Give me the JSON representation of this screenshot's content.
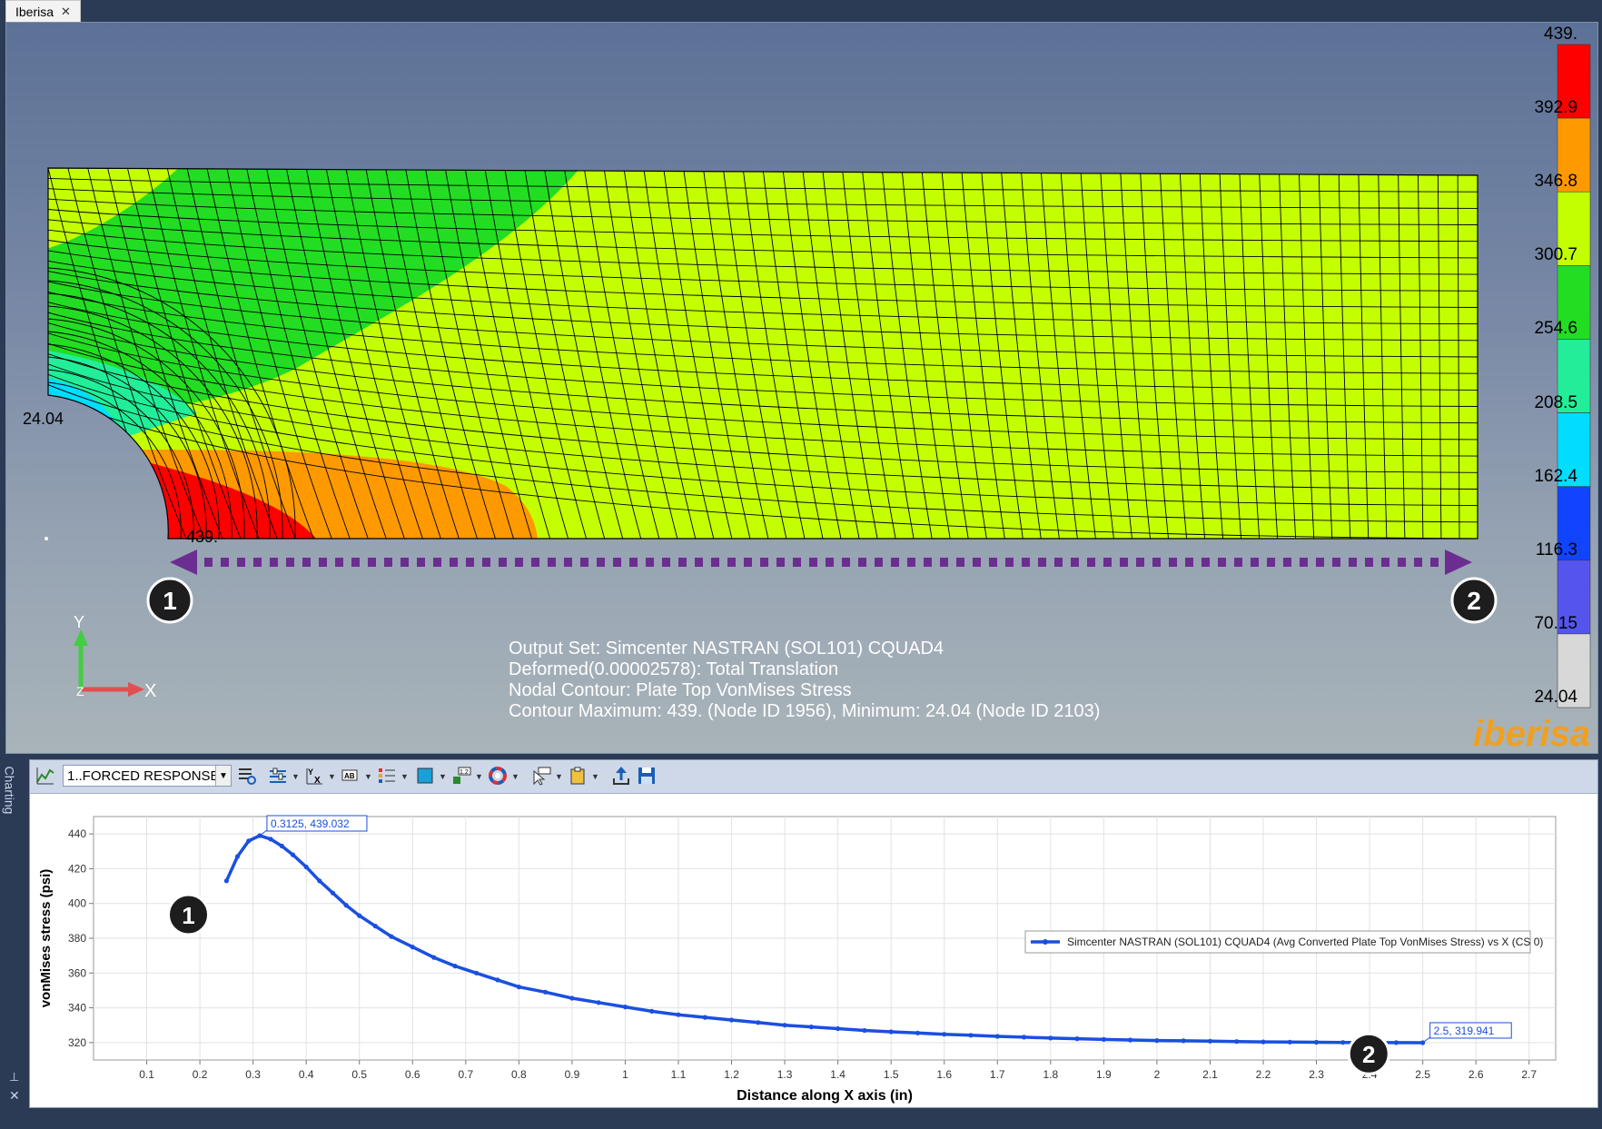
{
  "window": {
    "tab_label": "Iberisa",
    "tab_close": "✕"
  },
  "viewport": {
    "legend": [
      "439.",
      "392.9",
      "346.8",
      "300.7",
      "254.6",
      "208.5",
      "162.4",
      "116.3",
      "70.15",
      "24.04"
    ],
    "legend_colors": [
      "#ff0000",
      "#ff9900",
      "#c4ff00",
      "#22dd22",
      "#22ee99",
      "#00ddff",
      "#1144ff",
      "#5555ee",
      "#d8d8d8"
    ],
    "contour_min_label": "24.04",
    "contour_max_label": "439.",
    "markers": {
      "start": "1",
      "end": "2"
    },
    "axes": {
      "y": "Y",
      "x": "X",
      "z": "Z"
    },
    "info_lines": [
      "Output Set: Simcenter NASTRAN (SOL101) CQUAD4",
      "Deformed(0.00002578): Total Translation",
      "Nodal Contour: Plate Top VonMises Stress",
      "Contour Maximum: 439. (Node ID 1956), Minimum: 24.04 (Node ID 2103)"
    ],
    "logo": "iberisa"
  },
  "side_panel": {
    "label": "Charting",
    "pin": "⊥",
    "close": "✕"
  },
  "toolbar": {
    "chart_select": "1..FORCED RESPONSE"
  },
  "chart_data": {
    "type": "line",
    "xlabel": "Distance along X axis (in)",
    "ylabel": "vonMises stress (psi)",
    "xlim": [
      0.0,
      2.75
    ],
    "ylim": [
      310,
      450
    ],
    "xticks": [
      "0.1",
      "0.2",
      "0.3",
      "0.4",
      "0.5",
      "0.6",
      "0.7",
      "0.8",
      "0.9",
      "1",
      "1.1",
      "1.2",
      "1.3",
      "1.4",
      "1.5",
      "1.6",
      "1.7",
      "1.8",
      "1.9",
      "2",
      "2.1",
      "2.2",
      "2.3",
      "2.4",
      "2.5",
      "2.6",
      "2.7"
    ],
    "yticks": [
      "320",
      "340",
      "360",
      "380",
      "400",
      "420",
      "440"
    ],
    "grid": true,
    "legend_position": "right",
    "series": [
      {
        "name": "Simcenter NASTRAN (SOL101) CQUAD4 (Avg Converted Plate Top VonMises Stress) vs X (CS 0)",
        "color": "#1a4fe0",
        "x": [
          0.25,
          0.2708,
          0.2917,
          0.3125,
          0.3333,
          0.3542,
          0.375,
          0.4,
          0.425,
          0.45,
          0.475,
          0.5,
          0.53,
          0.56,
          0.6,
          0.64,
          0.68,
          0.72,
          0.76,
          0.8,
          0.85,
          0.9,
          0.95,
          1.0,
          1.05,
          1.1,
          1.15,
          1.2,
          1.25,
          1.3,
          1.35,
          1.4,
          1.45,
          1.5,
          1.55,
          1.6,
          1.65,
          1.7,
          1.75,
          1.8,
          1.85,
          1.9,
          1.95,
          2.0,
          2.05,
          2.1,
          2.15,
          2.2,
          2.25,
          2.3,
          2.35,
          2.4,
          2.45,
          2.5
        ],
        "y": [
          413,
          427,
          436,
          439.032,
          437,
          433,
          428,
          421,
          413,
          406,
          399,
          393,
          387,
          381,
          375,
          369,
          364,
          360,
          356,
          352,
          349,
          345.5,
          343,
          340.5,
          338,
          336,
          334.5,
          333,
          331.5,
          330,
          329,
          328,
          327,
          326.2,
          325.5,
          324.8,
          324.2,
          323.6,
          323.1,
          322.6,
          322.2,
          321.8,
          321.5,
          321.2,
          321,
          320.8,
          320.6,
          320.4,
          320.3,
          320.2,
          320.1,
          320,
          319.97,
          319.941
        ]
      }
    ],
    "annotations": [
      {
        "text": "0.3125, 439.032",
        "x": 0.3125,
        "y": 439.032
      },
      {
        "text": "2.5, 319.941",
        "x": 2.5,
        "y": 319.941
      }
    ],
    "markers": [
      {
        "text": "1",
        "x": 0.24,
        "y": 404
      },
      {
        "text": "2",
        "x": 2.46,
        "y": 324
      }
    ]
  }
}
